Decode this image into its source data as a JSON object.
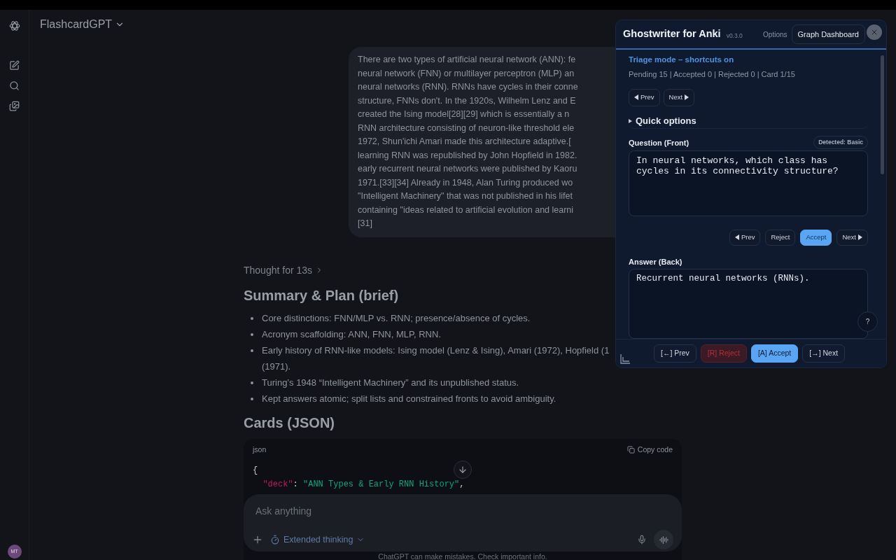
{
  "app": {
    "title": "FlashcardGPT",
    "avatar": "MT"
  },
  "user_message": {
    "lines": [
      "There are two types of artificial neural network (ANN): fe",
      "neural network (FNN) or multilayer perceptron (MLP) an",
      "neural networks (RNN). RNNs have cycles in their conne",
      "structure, FNNs don't. In the 1920s, Wilhelm Lenz and E",
      "created the Ising model[28][29] which is essentially a n",
      "RNN architecture consisting of neuron-like threshold ele",
      "1972, Shun'ichi Amari made this architecture adaptive.[",
      "learning RNN was republished by John Hopfield in 1982.",
      "early recurrent neural networks were published by Kaoru",
      "1971.[33][34] Already in 1948, Alan Turing produced wo",
      "\"Intelligent Machinery\" that was not published in his lifet",
      "containing \"ideas related to artificial evolution and learni",
      "[31]"
    ]
  },
  "thought": "Thought for 13s",
  "summary": {
    "heading": "Summary & Plan (brief)",
    "bullets": [
      {
        "lines": [
          "Core distinctions: FNN/MLP vs. RNN; presence/absence of cycles."
        ]
      },
      {
        "lines": [
          "Acronym scaffolding: ANN, FNN, MLP, RNN."
        ]
      },
      {
        "lines": [
          "Early history of RNN-like models: Ising model (Lenz & Ising), Amari (1972), Hopfield (1",
          "(1971)."
        ]
      },
      {
        "lines": [
          "Turing’s 1948 “Intelligent Machinery” and its unpublished status."
        ]
      },
      {
        "lines": [
          "Kept answers atomic; split lists and constrained fronts to avoid ambiguity."
        ]
      }
    ]
  },
  "cards": {
    "heading": "Cards (JSON)",
    "language": "json",
    "copy": "Copy code",
    "code": [
      [
        {
          "kind": "punct",
          "text": "{"
        }
      ],
      [
        {
          "kind": "key",
          "text": "  \"deck\""
        },
        {
          "kind": "punct",
          "text": ": "
        },
        {
          "kind": "string",
          "text": "\"ANN Types & Early RNN History\""
        },
        {
          "kind": "punct",
          "text": ","
        }
      ]
    ]
  },
  "composer": {
    "placeholder": "Ask anything",
    "mode": "Extended thinking"
  },
  "footer": "ChatGPT can make mistakes. Check important info.",
  "panel": {
    "title": "Ghostwriter for Anki",
    "version": "v0.3.0",
    "options": "Options",
    "dashboard": "Graph Dashboard",
    "triage": "Triage mode – shortcuts on",
    "stats": "Pending 15 | Accepted 0 | Rejected 0 | Card 1/15",
    "nav": [
      "Prev",
      "Next"
    ],
    "quick_options": {
      "label": "Quick options",
      "expanded": false
    },
    "question": {
      "label": "Question (Front)",
      "detected": "Detected: Basic",
      "value": "In neural networks, which class has cycles in its connectivity structure?"
    },
    "card_buttons": [
      {
        "label": "Prev",
        "kind": "prev",
        "selected": false
      },
      {
        "label": "Reject",
        "kind": "plain",
        "selected": false
      },
      {
        "label": "Accept",
        "kind": "plain",
        "selected": true
      },
      {
        "label": "Next",
        "kind": "next",
        "selected": false
      }
    ],
    "answer": {
      "label": "Answer (Back)",
      "value": "Recurrent neural networks (RNNs)."
    },
    "help": "?",
    "bottom_buttons": [
      {
        "label": "[←] Prev",
        "kind": "neutral"
      },
      {
        "label": "[R] Reject",
        "kind": "danger"
      },
      {
        "label": "[A] Accept",
        "kind": "primary"
      },
      {
        "label": "[→] Next",
        "kind": "neutral"
      }
    ]
  }
}
